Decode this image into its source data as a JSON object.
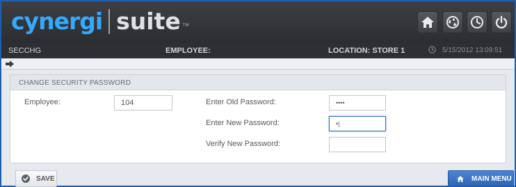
{
  "header": {
    "logo_part1": "cynergi",
    "logo_part2": "suite",
    "logo_tm": "™",
    "buttons": [
      "home-icon",
      "globe-icon",
      "clock-icon",
      "power-icon"
    ]
  },
  "status": {
    "screen_code": "SECCHG",
    "employee_label": "EMPLOYEE:",
    "location_label": "LOCATION:  STORE 1",
    "datetime": "5/15/2012 13:09:51"
  },
  "panel": {
    "title": "CHANGE SECURITY PASSWORD",
    "employee_label": "Employee:",
    "employee_value": "104",
    "old_password_label": "Enter Old Password:",
    "old_password_value": "••••",
    "new_password_label": "Enter New Password:",
    "new_password_value": "•|",
    "verify_password_label": "Verify New Password:",
    "verify_password_value": ""
  },
  "footer": {
    "save_label": "SAVE",
    "main_menu_label": "MAIN MENU"
  },
  "colors": {
    "brand_blue": "#33aaff",
    "header_bg": "#2d2f32",
    "primary_button": "#2d64b4"
  }
}
